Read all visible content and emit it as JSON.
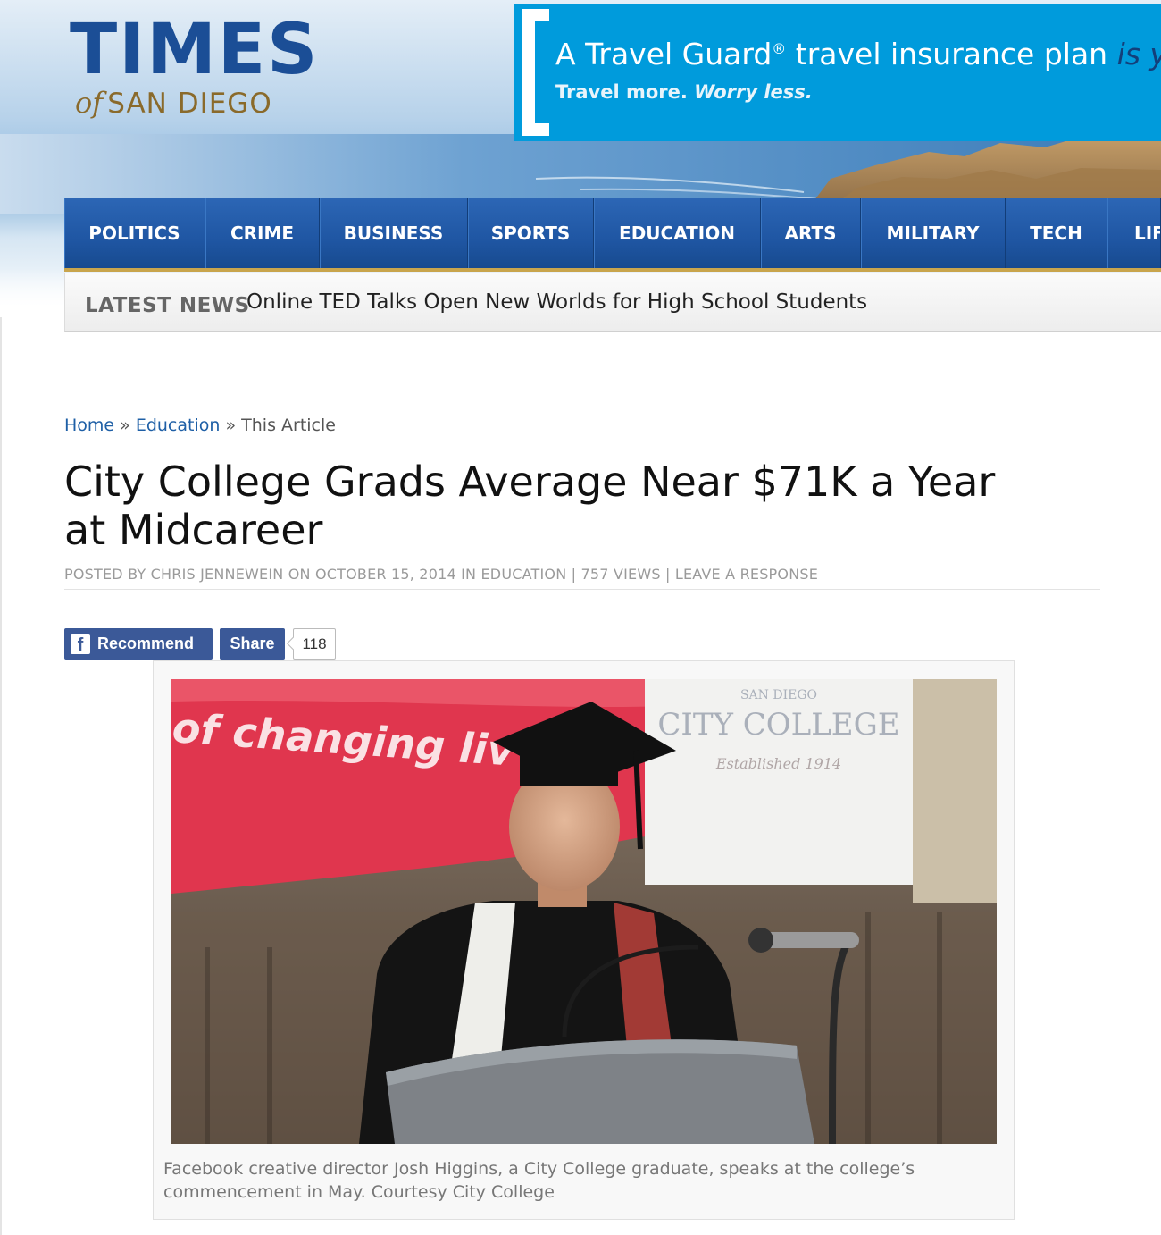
{
  "site": {
    "logo_main": "TIMES",
    "logo_of": "of",
    "logo_city": "SAN DIEGO"
  },
  "ad": {
    "headline_pre": "A Travel Guard",
    "headline_reg": "®",
    "headline_mid": " travel insurance plan",
    "headline_tail": " is your",
    "tagline_a": "Travel more.",
    "tagline_b": " Worry less.",
    "accent_color": "#009bdc"
  },
  "nav": {
    "items": [
      "POLITICS",
      "CRIME",
      "BUSINESS",
      "SPORTS",
      "EDUCATION",
      "ARTS",
      "MILITARY",
      "TECH",
      "LIF"
    ]
  },
  "latest_news": {
    "label": "LATEST NEWS",
    "headline": "Online TED Talks Open New Worlds for High School Students"
  },
  "breadcrumb": {
    "home": "Home",
    "sep": "»",
    "section": "Education",
    "current": "This Article"
  },
  "article": {
    "title": "City College Grads Average Near $71K a Year at Midcareer",
    "meta": "POSTED BY CHRIS JENNEWEIN ON OCTOBER 15, 2014 IN EDUCATION  |  757 VIEWS  |  LEAVE A RESPONSE"
  },
  "social": {
    "recommend": "Recommend",
    "share": "Share",
    "count": "118"
  },
  "figure": {
    "banner_text": "of changing liv",
    "sign_line1": "SAN DIEGO",
    "sign_line2": "CITY COLLEGE",
    "sign_line3": "Established 1914",
    "caption": "Facebook creative director Josh Higgins, a City College graduate, speaks at the college’s commencement in May. Courtesy City College"
  }
}
